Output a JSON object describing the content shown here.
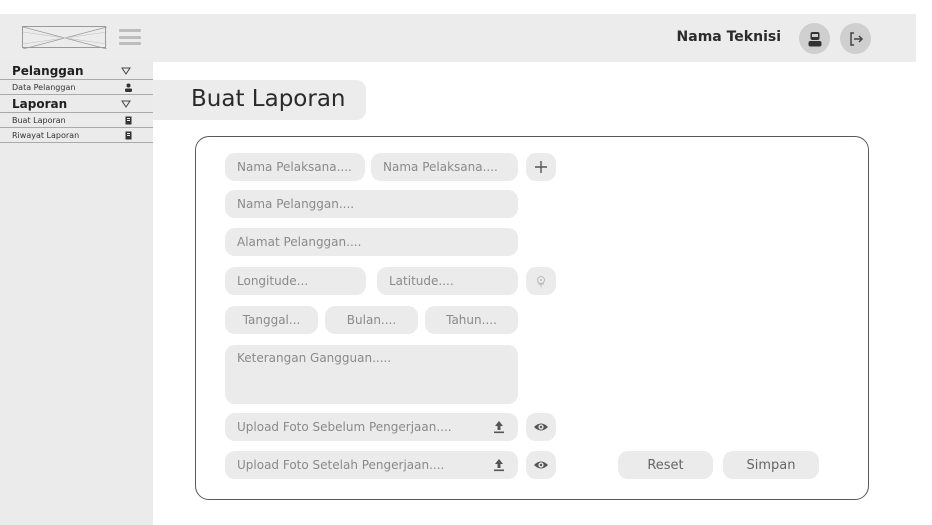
{
  "header": {
    "user_name": "Nama Teknisi",
    "icons": [
      "logo-placeholder",
      "menu-icon",
      "user-icon",
      "logout-icon"
    ]
  },
  "sidebar": {
    "sections": [
      {
        "title": "Pelanggan",
        "items": [
          {
            "label": "Data Pelanggan",
            "icon": "user-icon"
          }
        ]
      },
      {
        "title": "Laporan",
        "items": [
          {
            "label": "Buat Laporan",
            "icon": "report-icon"
          },
          {
            "label": "Riwayat Laporan",
            "icon": "report-icon"
          }
        ]
      }
    ]
  },
  "page": {
    "title": "Buat Laporan"
  },
  "form": {
    "pelaksana_1": "Nama Pelaksana....",
    "pelaksana_2": "Nama Pelaksana....",
    "pelanggan": "Nama Pelanggan....",
    "alamat": "Alamat Pelanggan....",
    "longitude": "Longitude...",
    "latitude": "Latitude....",
    "tanggal": "Tanggal...",
    "bulan": "Bulan....",
    "tahun": "Tahun....",
    "keterangan": "Keterangan Gangguan.....",
    "upload_before": "Upload Foto Sebelum Pengerjaan....",
    "upload_after": "Upload Foto Setelah Pengerjaan....",
    "reset_label": "Reset",
    "save_label": "Simpan"
  },
  "colors": {
    "panel": "#ebebeb",
    "border": "#5a5a5a",
    "placeholder": "#8a8a8a"
  }
}
